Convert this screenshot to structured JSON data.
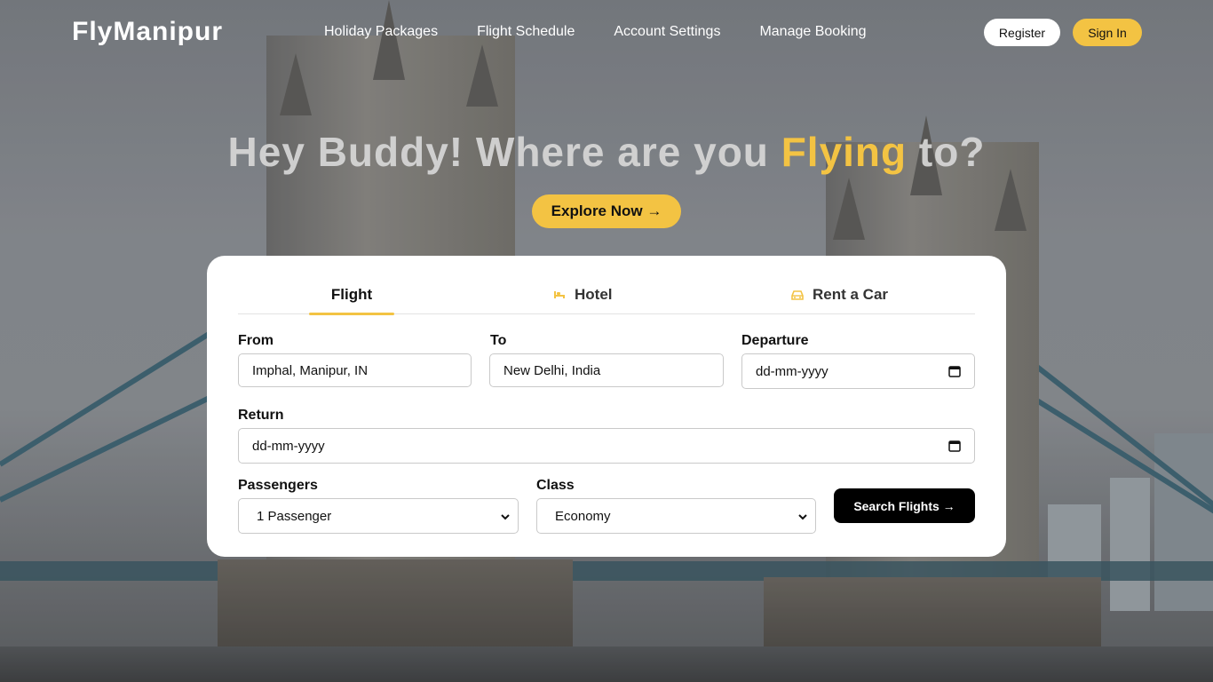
{
  "header": {
    "logo": "FlyManipur",
    "nav": [
      "Holiday Packages",
      "Flight Schedule",
      "Account Settings",
      "Manage Booking"
    ],
    "register_label": "Register",
    "signin_label": "Sign In"
  },
  "hero": {
    "title_before": "Hey Buddy! Where are you ",
    "title_highlight": "Flying",
    "title_after": " to?",
    "explore_label": "Explore Now →"
  },
  "booking": {
    "tabs": [
      {
        "label": "Flight",
        "icon": "none",
        "active": true
      },
      {
        "label": "Hotel",
        "icon": "bed-icon",
        "active": false
      },
      {
        "label": "Rent a Car",
        "icon": "car-icon",
        "active": false
      }
    ],
    "from": {
      "label": "From",
      "value": "Imphal, Manipur, IN"
    },
    "to": {
      "label": "To",
      "value": "New Delhi, India"
    },
    "departure": {
      "label": "Departure",
      "value": "dd-mm-yyyy"
    },
    "return": {
      "label": "Return",
      "value": "dd-mm-yyyy"
    },
    "passengers": {
      "label": "Passengers",
      "value": "1 Passenger"
    },
    "class": {
      "label": "Class",
      "value": "Economy"
    },
    "search_label": "Search Flights →"
  },
  "colors": {
    "accent": "#f3c343",
    "text": "#111111",
    "card": "#ffffff"
  }
}
